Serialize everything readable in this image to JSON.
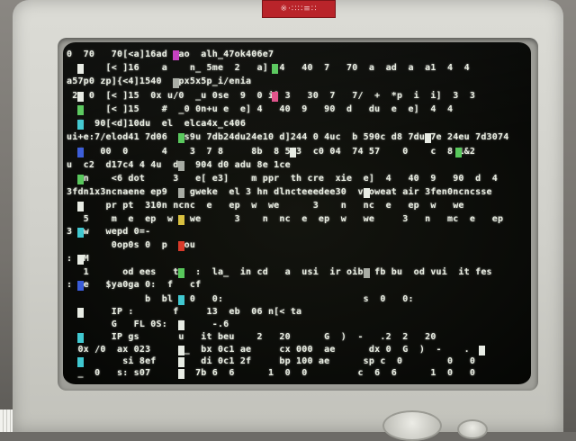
{
  "sticker": {
    "text": "※·∷∷≡∷"
  },
  "screen": {
    "lines": [
      "0  70   70[<a]16ad  ao  alh_47ok406e7",
      "       [< ]16    a    n_ 5me  2   a]  4   40  7   70  a  ad  a  a1  4  4",
      "a57p0 zp]{<4]1540  xpx5x5p_i/enia",
      " 2  0  [< ]15  0x u/0  _u 0se  9  0 i] 3   30  7   7/  +  *p  i  i]  3  3",
      "       [< ]15    #  _0 0n+u e  e] 4   40  9   90  d   du  e  e]  4  4",
      "  0  90[<d]10du  el  elca4x_c406",
      "ui+e:7/elod41 7d06   s9u 7db24du24e10 d]244 0 4uc  b 590c d8 7du 7e 24eu 7d3074",
      "  4   00  0      4    3  7 8     8b  8 543  c0 04  74 57    0    c  8 1&2",
      "u  c2  d17c4 4 4u  d8  904 d0 adu 8e 1ce",
      "   n    <6 dot     3   e[ e3]    m ppr  th cre  xie  e]  4   40  9   90  d  4",
      "3fdn1x3ncnaene ep9  n gweke  el 3 hn dlncteeedee30  vpoweat air 3fen0ncncsse",
      "       pr pt  310n ncnc  e   ep  w  we      3    n   nc  e   ep  w   we",
      "   5    m  e  ep  w   we      3    n  nc  e  ep  w   we     3   n   mc  e   ep",
      "3  w   wepd 0=-",
      "        0op0s 0  p   ou",
      ":  M",
      "   1      od ees   t   :  la_  in cd   a  usi  ir oib  fb bu  od vui  it fes",
      ":  e   $ya0ga 0:  f   cf",
      "              b  bl s 0   0:                         s  0   0:",
      "        IP :       f     13  eb  06 n[< ta",
      "        G   FL 0S:  2     -.6",
      "        IP gs       u   it beu    2   20      G  )  -   .2  2   20",
      "  0x /0  ax 023     e_  bx 0c1 ae     cx 000  ae      dx 0  G  )  -    .",
      "          si 8ef        di 0c1 2f     bp 100 ae      sp c  0        0   0",
      "  _  0   s: s07        7b 6  6      1  0  0         c  6  6      1  0   0"
    ]
  },
  "colors": {
    "green": "#58c85c",
    "magenta": "#c43cc0",
    "pink": "#e0528a",
    "cyan": "#40c8d0",
    "blue": "#3a5cd8",
    "red": "#d83a2a",
    "yellow": "#d8c040",
    "white": "#e8ece4",
    "gray": "#a8aca4"
  }
}
